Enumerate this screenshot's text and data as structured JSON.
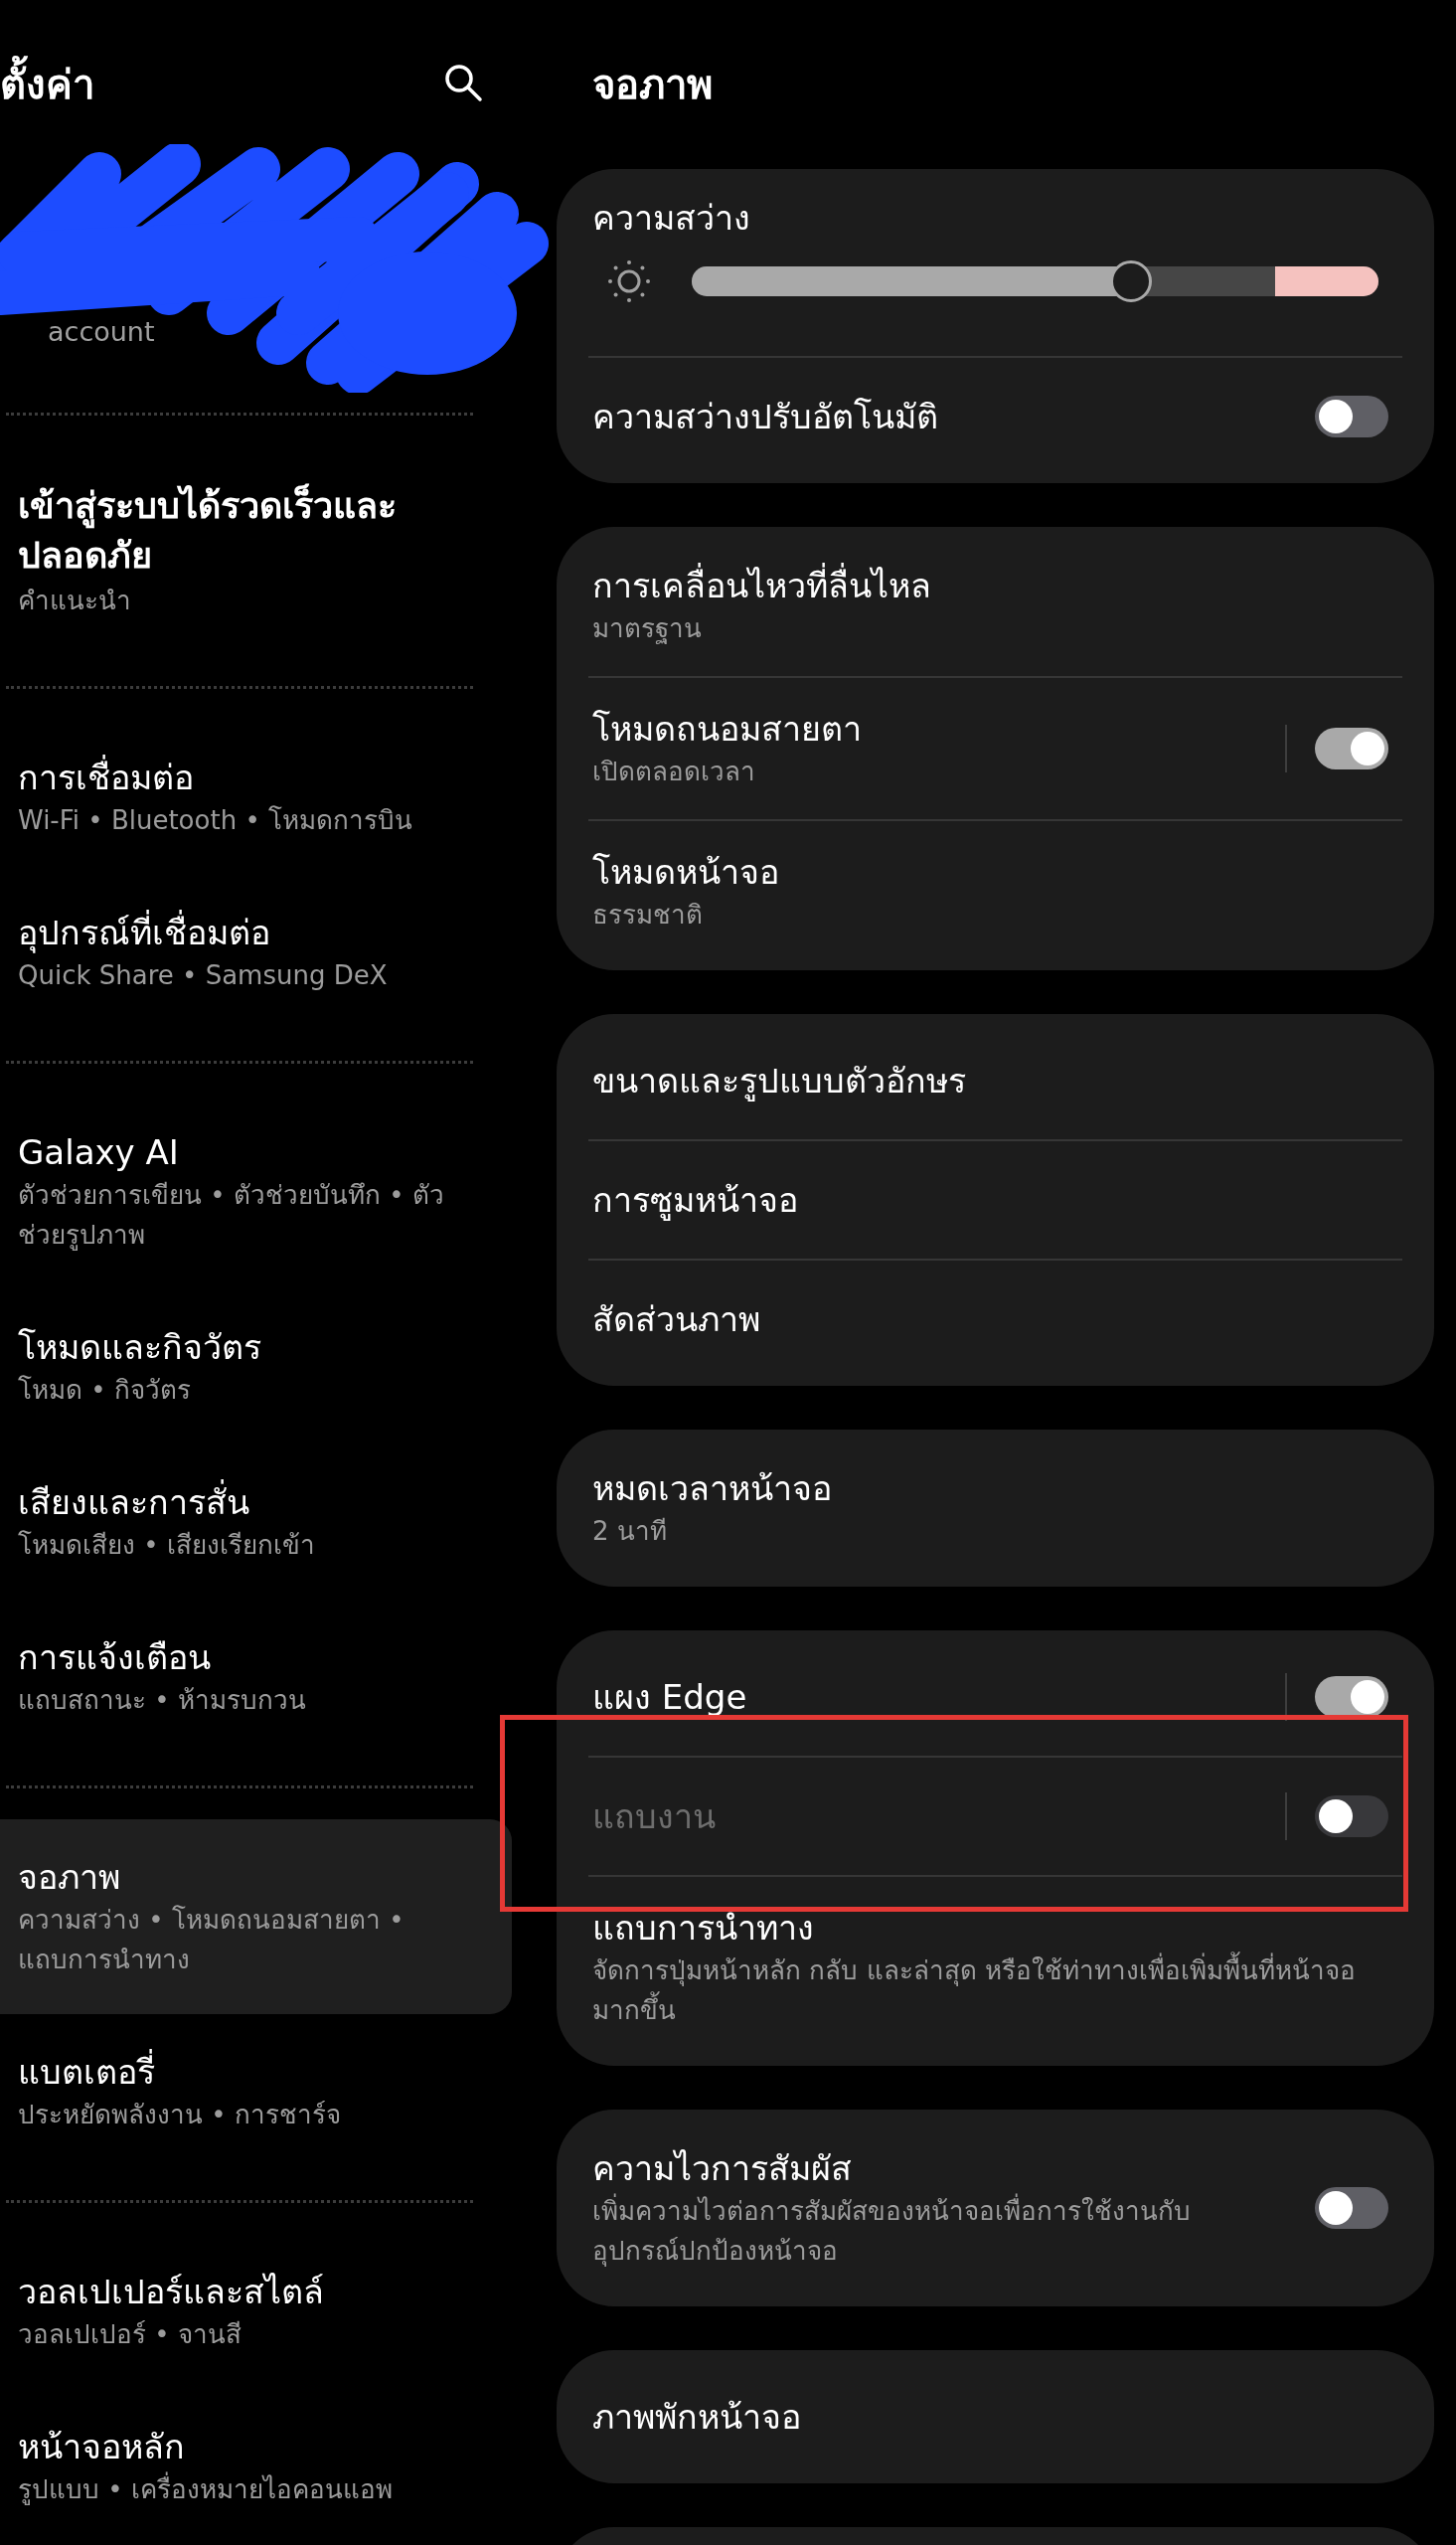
{
  "sidebar": {
    "title": "ตั้งค่า",
    "account": {
      "subtitle": "account"
    },
    "groups": [
      [
        {
          "kind": "suggestion",
          "title": "เข้าสู่ระบบได้รวดเร็วและปลอดภัย",
          "subtitle": "คำแนะนำ",
          "selected": false
        }
      ],
      [
        {
          "kind": "menu",
          "title": "การเชื่อมต่อ",
          "subtitle": "Wi-Fi  •  Bluetooth  •  โหมดการบิน",
          "selected": false
        },
        {
          "kind": "menu",
          "title": "อุปกรณ์ที่เชื่อมต่อ",
          "subtitle": "Quick Share  •  Samsung DeX",
          "selected": false
        }
      ],
      [
        {
          "kind": "menu",
          "title": "Galaxy AI",
          "subtitle": "ตัวช่วยการเขียน  •  ตัวช่วยบันทึก  •  ตัวช่วยรูปภาพ",
          "selected": false
        },
        {
          "kind": "menu",
          "title": "โหมดและกิจวัตร",
          "subtitle": "โหมด  •  กิจวัตร",
          "selected": false
        },
        {
          "kind": "menu",
          "title": "เสียงและการสั่น",
          "subtitle": "โหมดเสียง  •  เสียงเรียกเข้า",
          "selected": false
        },
        {
          "kind": "menu",
          "title": "การแจ้งเตือน",
          "subtitle": "แถบสถานะ  •  ห้ามรบกวน",
          "selected": false
        }
      ],
      [
        {
          "kind": "menu",
          "title": "จอภาพ",
          "subtitle": "ความสว่าง  •  โหมดถนอมสายตา  •  แถบการนำทาง",
          "selected": true
        },
        {
          "kind": "menu",
          "title": "แบตเตอรี่",
          "subtitle": "ประหยัดพลังงาน  •  การชาร์จ",
          "selected": false
        }
      ],
      [
        {
          "kind": "menu",
          "title": "วอลเปเปอร์และสไตล์",
          "subtitle": "วอลเปเปอร์  •  จานสี",
          "selected": false
        },
        {
          "kind": "menu",
          "title": "หน้าจอหลัก",
          "subtitle": "รูปแบบ  •  เครื่องหมายไอคอนแอพ",
          "selected": false
        }
      ]
    ]
  },
  "main": {
    "title": "จอภาพ",
    "cards": [
      {
        "rows": [
          {
            "kind": "slider",
            "title": "ความสว่าง",
            "level": 0.64
          },
          {
            "kind": "switch",
            "title": "ความสว่างปรับอัตโนมัติ",
            "on": false,
            "disabled": false
          }
        ]
      },
      {
        "rows": [
          {
            "kind": "link",
            "title": "การเคลื่อนไหวที่ลื่นไหล",
            "subtitle": "มาตรฐาน"
          },
          {
            "kind": "split_switch",
            "title": "โหมดถนอมสายตา",
            "subtitle": "เปิดตลอดเวลา",
            "on": true,
            "disabled": false
          },
          {
            "kind": "link",
            "title": "โหมดหน้าจอ",
            "subtitle": "ธรรมชาติ"
          }
        ]
      },
      {
        "rows": [
          {
            "kind": "link",
            "title": "ขนาดและรูปแบบตัวอักษร"
          },
          {
            "kind": "link",
            "title": "การซูมหน้าจอ"
          },
          {
            "kind": "link",
            "title": "สัดส่วนภาพ"
          }
        ]
      },
      {
        "rows": [
          {
            "kind": "link",
            "title": "หมดเวลาหน้าจอ",
            "subtitle": "2 นาที"
          }
        ]
      },
      {
        "rows": [
          {
            "kind": "split_switch",
            "title": "แผง Edge",
            "on": true,
            "disabled": false
          },
          {
            "kind": "split_switch",
            "title": "แถบงาน",
            "on": false,
            "disabled": true
          },
          {
            "kind": "link",
            "title": "แถบการนำทาง",
            "subtitle": "จัดการปุ่มหน้าหลัก กลับ และล่าสุด หรือใช้ท่าทางเพื่อเพิ่มพื้นที่หน้าจอมากขึ้น"
          }
        ]
      },
      {
        "rows": [
          {
            "kind": "switch",
            "title": "ความไวการสัมผัส",
            "subtitle": "เพิ่มความไวต่อการสัมผัสของหน้าจอเพื่อการใช้งานกับอุปกรณ์ปกป้องหน้าจอ",
            "on": false,
            "disabled": false
          }
        ]
      },
      {
        "rows": [
          {
            "kind": "link",
            "title": "ภาพพักหน้าจอ"
          }
        ]
      },
      {
        "kind": "cut_off"
      }
    ]
  }
}
